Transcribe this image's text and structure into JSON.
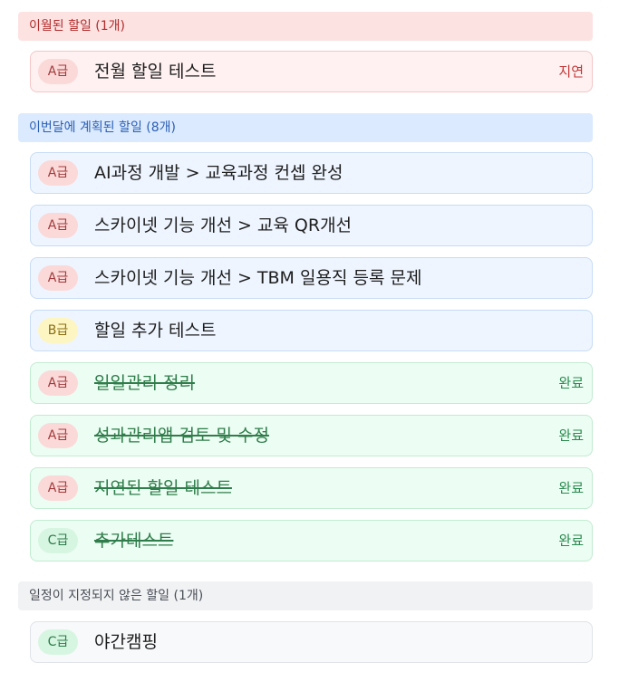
{
  "overdue": {
    "header": "이월된 할일 (1개)",
    "tasks": [
      {
        "grade": "A급",
        "title": "전월 할일 테스트",
        "status": "지연"
      }
    ]
  },
  "planned": {
    "header": "이번달에 계획된 할일 (8개)",
    "tasks": [
      {
        "grade": "A급",
        "title": "AI과정 개발 > 교육과정 컨셉 완성"
      },
      {
        "grade": "A급",
        "title": "스카이넷 기능 개선 > 교육 QR개선"
      },
      {
        "grade": "A급",
        "title": "스카이넷 기능 개선 > TBM 일용직 등록 문제"
      },
      {
        "grade": "B급",
        "title": "할일 추가 테스트"
      },
      {
        "grade": "A급",
        "title": "일일관리 정리",
        "status": "완료"
      },
      {
        "grade": "A급",
        "title": "성과관리앱 검토 및 수정",
        "status": "완료"
      },
      {
        "grade": "A급",
        "title": "지연된 할일 테스트",
        "status": "완료"
      },
      {
        "grade": "C급",
        "title": "추가테스트",
        "status": "완료"
      }
    ]
  },
  "unscheduled": {
    "header": "일정이 지정되지 않은 할일 (1개)",
    "tasks": [
      {
        "grade": "C급",
        "title": "야간캠핑"
      }
    ]
  },
  "colors": {
    "overdue_accent": "#c23434",
    "planned_accent": "#2b5fb4",
    "done_accent": "#2a8a4e"
  }
}
